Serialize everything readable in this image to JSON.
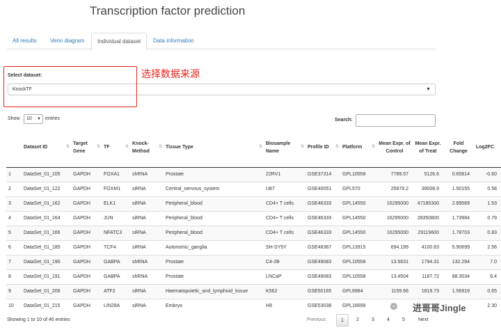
{
  "title": "Transcription factor prediction",
  "tabs": [
    "All results",
    "Venn diagram",
    "Individual dataset",
    "Data information"
  ],
  "active_tab": "Individual dataset",
  "select": {
    "label": "Select dataset:",
    "value": "KnockTF",
    "caret_icon": "caret-down-icon"
  },
  "annotation": "选择数据来源",
  "length": {
    "show": "Show",
    "value": "10",
    "entries": "entries"
  },
  "search": {
    "label": "Search:",
    "value": ""
  },
  "table": {
    "headers": [
      "",
      "Dataset ID",
      "Target Gene",
      "TF",
      "Knock-Method",
      "Tissue Type",
      "Biosample Name",
      "Profile ID",
      "Platform",
      "Mean Expr. of Control",
      "Mean Expr. of Treat",
      "Fold Change",
      "Log2FC"
    ],
    "rows": [
      [
        "1",
        "DataSet_01_105",
        "GAPDH",
        "FOXA1",
        "shRNA",
        "Prostate",
        "22RV1",
        "GSE37314",
        "GPL10558",
        "7789.57",
        "5126.6",
        "0.65814",
        "-0.60"
      ],
      [
        "2",
        "DataSet_01_122",
        "GAPDH",
        "FOXM1",
        "siRNA",
        "Central_nervous_system",
        "U87",
        "GSE40051",
        "GPL570",
        "25979.2",
        "39008.9",
        "1.50155",
        "0.58"
      ],
      [
        "3",
        "DataSet_01_162",
        "GAPDH",
        "ELK1",
        "siRNA",
        "Peripheral_blood",
        "CD4+ T cells",
        "GSE46333",
        "GPL14550",
        "16295000",
        "47185300",
        "2.89569",
        "1.53"
      ],
      [
        "4",
        "DataSet_01_164",
        "GAPDH",
        "JUN",
        "siRNA",
        "Peripheral_blood",
        "CD4+ T cells",
        "GSE46333",
        "GPL14550",
        "16295000",
        "28350800",
        "1.73984",
        "0.79"
      ],
      [
        "5",
        "DataSet_01_166",
        "GAPDH",
        "NFATC3",
        "siRNA",
        "Peripheral_blood",
        "CD4+ T cells",
        "GSE46333",
        "GPL14550",
        "16295000",
        "29119600",
        "1.78703",
        "0.83"
      ],
      [
        "6",
        "DataSet_01_185",
        "GAPDH",
        "TCF4",
        "siRNA",
        "Autonomic_ganglia",
        "SH-SY5Y",
        "GSE48367",
        "GPL13915",
        "694.199",
        "4100.63",
        "5.90699",
        "2.56"
      ],
      [
        "7",
        "DataSet_01_190",
        "GAPDH",
        "GABPA",
        "shRNA",
        "Prostate",
        "C4-2B",
        "GSE49083",
        "GPL10558",
        "13.5631",
        "1794.31",
        "132.294",
        "7.0"
      ],
      [
        "8",
        "DataSet_01_191",
        "GAPDH",
        "GABPA",
        "shRNA",
        "Prostate",
        "LNCaP",
        "GSE49083",
        "GPL10558",
        "13.4504",
        "1187.72",
        "88.3034",
        "6.4"
      ],
      [
        "9",
        "DataSet_01_206",
        "GAPDH",
        "ATF2",
        "siRNA",
        "Haematopoietic_and_lymphoid_tissue",
        "K562",
        "GSE50165",
        "GPL6884",
        "1159.66",
        "1819.73",
        "1.56919",
        "0.65"
      ],
      [
        "10",
        "DataSet_01_215",
        "GAPDH",
        "LIN28A",
        "siRNA",
        "Embryo",
        "H9",
        "GSE53038",
        "GPL16699",
        "",
        "",
        "",
        "2.30"
      ]
    ]
  },
  "info": "Showing 1 to 10 of 46 entries",
  "pagination": {
    "previous": "Previous",
    "pages": [
      "1",
      "2",
      "3",
      "4",
      "5"
    ],
    "current": "1",
    "next": "Next"
  },
  "watermark": {
    "text": "进哥哥Jingle",
    "icon": "wechat-icon"
  }
}
